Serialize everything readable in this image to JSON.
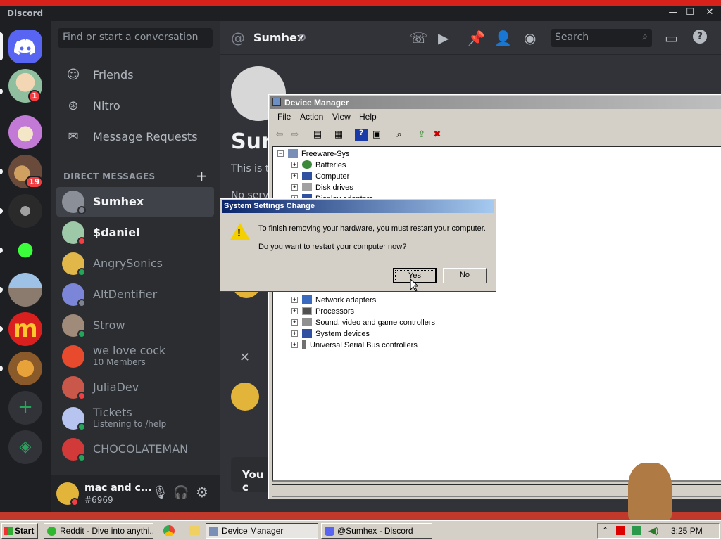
{
  "discord": {
    "app_title": "Discord",
    "window_controls": {
      "minimize": "—",
      "maximize": "☐",
      "close": "✕"
    },
    "servers": [
      {
        "name": "server-family-guy",
        "badge": "1"
      },
      {
        "name": "server-anime-group",
        "badge": ""
      },
      {
        "name": "server-duck-hat",
        "badge": "19"
      },
      {
        "name": "server-dark-art",
        "badge": ""
      },
      {
        "name": "server-troll-face",
        "badge": ""
      },
      {
        "name": "server-building",
        "badge": ""
      },
      {
        "name": "server-mcdonalds",
        "badge": ""
      },
      {
        "name": "server-burger",
        "badge": ""
      }
    ],
    "search_placeholder": "Find or start a conversation",
    "nav": [
      {
        "label": "Friends"
      },
      {
        "label": "Nitro"
      },
      {
        "label": "Message Requests"
      }
    ],
    "direct_messages_header": "DIRECT MESSAGES",
    "dms": [
      {
        "name": "Sumhex",
        "sub": "",
        "status": "offline"
      },
      {
        "name": "$daniel",
        "sub": "",
        "status": "dnd"
      },
      {
        "name": "AngrySonics",
        "sub": "",
        "status": "online"
      },
      {
        "name": "AltDentifier",
        "sub": "",
        "status": "offline"
      },
      {
        "name": "Strow",
        "sub": "",
        "status": "online"
      },
      {
        "name": "we love cock",
        "sub": "10 Members",
        "status": ""
      },
      {
        "name": "JuliaDev",
        "sub": "",
        "status": "dnd"
      },
      {
        "name": "Tickets",
        "sub": "Listening to /help",
        "status": "online"
      },
      {
        "name": "CHOCOLATEMAN",
        "sub": "",
        "status": "online"
      }
    ],
    "user": {
      "name": "mac and c...",
      "tag": "#6969"
    },
    "chat": {
      "channel_name": "Sumhex",
      "header_search_placeholder": "Search",
      "intro_title_partial": "Sum",
      "intro_text_partial": "This is t",
      "no_servers_partial": "No serve",
      "bottom_banner_partial": "You c",
      "close_symbol": "✕"
    }
  },
  "device_manager": {
    "title": "Device Manager",
    "menu": [
      "File",
      "Action",
      "View",
      "Help"
    ],
    "tree": [
      {
        "label": "Freeware-Sys",
        "expander": "−"
      },
      {
        "label": "Batteries",
        "expander": "+"
      },
      {
        "label": "Computer",
        "expander": "+"
      },
      {
        "label": "Disk drives",
        "expander": "+"
      },
      {
        "label": "Display adapters",
        "expander": "+"
      },
      {
        "label": "Network adapters",
        "expander": "+"
      },
      {
        "label": "Processors",
        "expander": "+"
      },
      {
        "label": "Sound, video and game controllers",
        "expander": "+"
      },
      {
        "label": "System devices",
        "expander": "+"
      },
      {
        "label": "Universal Serial Bus controllers",
        "expander": "+"
      }
    ]
  },
  "dialog": {
    "title": "System Settings Change",
    "line1": "To finish removing your hardware, you must restart your computer.",
    "line2": "Do you want to restart your computer now?",
    "yes": "Yes",
    "no": "No"
  },
  "taskbar": {
    "start": "Start",
    "tasks": [
      {
        "label": "Reddit - Dive into anythi..."
      },
      {
        "label": "Device Manager"
      },
      {
        "label": "@Sumhex - Discord"
      }
    ],
    "clock": "3:25 PM"
  },
  "colors": {
    "discord_blurple": "#5865f2",
    "online": "#23a55a",
    "dnd": "#f23f43",
    "offline": "#80848e",
    "xp_title_blue": "#0a246a"
  }
}
